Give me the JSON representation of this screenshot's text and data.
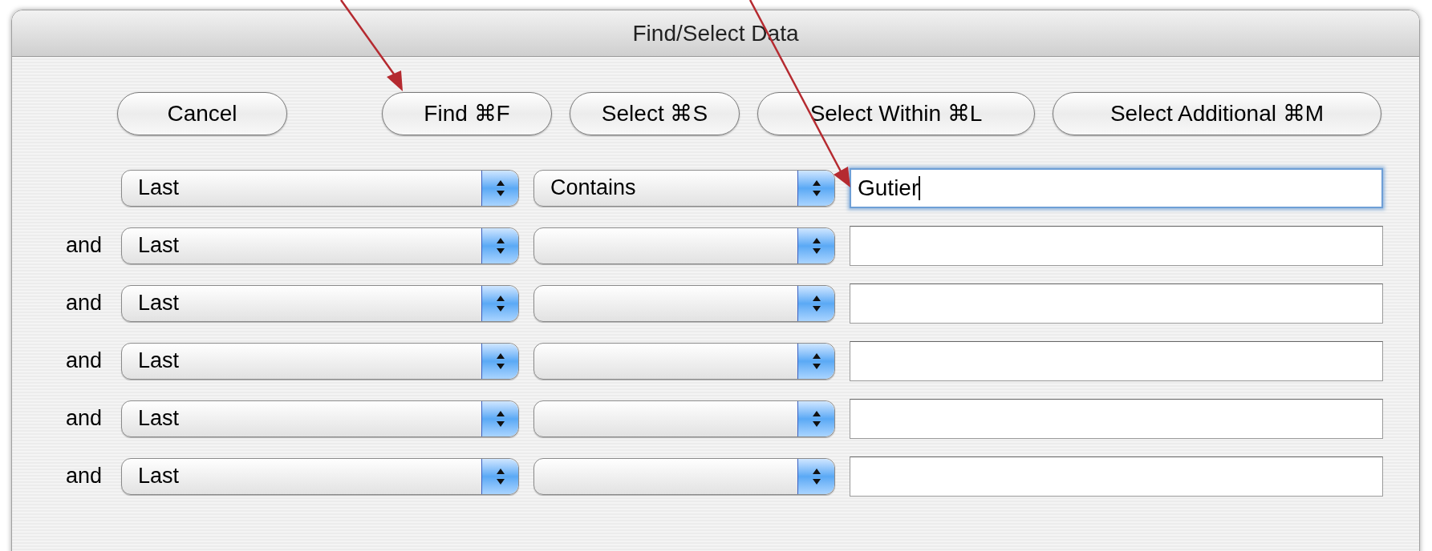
{
  "window": {
    "title": "Find/Select Data"
  },
  "buttons": [
    {
      "label": "Cancel"
    },
    {
      "label": "Find ⌘F"
    },
    {
      "label": "Select ⌘S"
    },
    {
      "label": "Select Within ⌘L"
    },
    {
      "label": "Select Additional ⌘M"
    }
  ],
  "rows": [
    {
      "field": "Last",
      "operator": "Contains",
      "value": "Gutier",
      "focused": true
    },
    {
      "connector": "and",
      "field": "Last",
      "focused": false
    },
    {
      "connector": "and",
      "field": "Last",
      "focused": false
    },
    {
      "connector": "and",
      "field": "Last",
      "focused": false
    },
    {
      "connector": "and",
      "field": "Last",
      "focused": false
    },
    {
      "connector": "and",
      "field": "Last",
      "focused": false
    }
  ]
}
